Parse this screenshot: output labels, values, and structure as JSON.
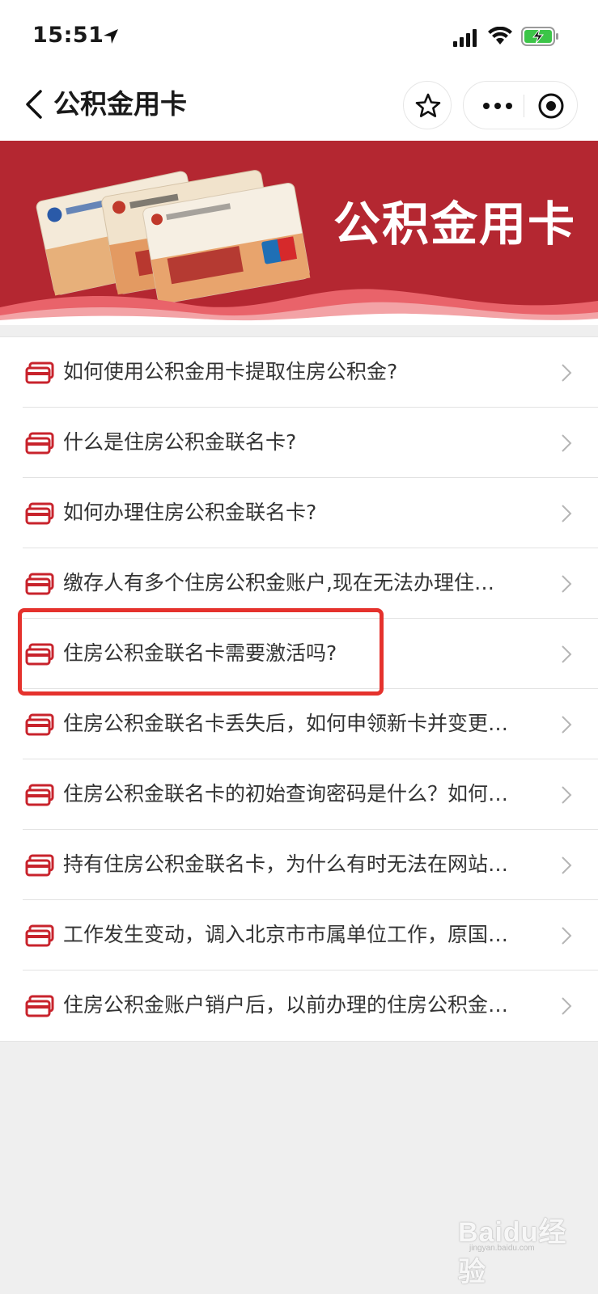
{
  "status_bar": {
    "time": "15:51"
  },
  "nav": {
    "title": "公积金用卡"
  },
  "banner": {
    "title": "公积金用卡"
  },
  "list": [
    {
      "text": "如何使用公积金用卡提取住房公积金?"
    },
    {
      "text": "什么是住房公积金联名卡?"
    },
    {
      "text": "如何办理住房公积金联名卡?"
    },
    {
      "text": "缴存人有多个住房公积金账户,现在无法办理住…"
    },
    {
      "text": "住房公积金联名卡需要激活吗?"
    },
    {
      "text": "住房公积金联名卡丢失后，如何申领新卡并变更…"
    },
    {
      "text": "住房公积金联名卡的初始查询密码是什么？如何…"
    },
    {
      "text": "持有住房公积金联名卡，为什么有时无法在网站…"
    },
    {
      "text": "工作发生变动，调入北京市市属单位工作，原国…"
    },
    {
      "text": "住房公积金账户销户后，以前办理的住房公积金…"
    }
  ],
  "highlighted_index": 4,
  "watermark": {
    "text": "Baidu经验",
    "sub": "jingyan.baidu.com"
  },
  "colors": {
    "banner_red": "#b42731",
    "icon_red": "#c8232c",
    "highlight_red": "#e5322d"
  },
  "icons": [
    "location-arrow-icon",
    "signal-icon",
    "wifi-icon",
    "battery-charging-icon",
    "back-icon",
    "star-icon",
    "more-icon",
    "close-target-icon",
    "card-icon",
    "chevron-right-icon"
  ]
}
